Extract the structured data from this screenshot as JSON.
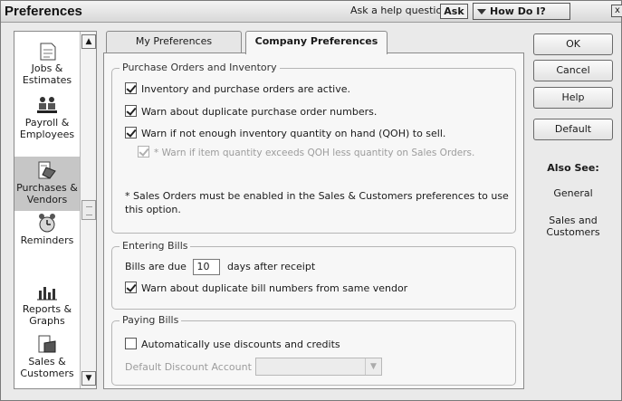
{
  "window": {
    "title": "Preferences"
  },
  "help": {
    "question_label": "Ask a help question",
    "ask_button": "Ask",
    "how_do_i": "How Do I?",
    "close_label": "x"
  },
  "icon_list": [
    {
      "label": "Jobs & Estimates",
      "icon": "jobs-estimates-icon"
    },
    {
      "label": "Payroll & Employees",
      "icon": "payroll-employees-icon"
    },
    {
      "label": "Purchases & Vendors",
      "icon": "purchases-vendors-icon",
      "selected": true
    },
    {
      "label": "Reminders",
      "icon": "reminders-icon"
    },
    {
      "label": "Reports & Graphs",
      "icon": "reports-graphs-icon"
    },
    {
      "label": "Sales & Customers",
      "icon": "sales-customers-icon"
    }
  ],
  "tabs": [
    {
      "label": "My Preferences",
      "active": false
    },
    {
      "label": "Company Preferences",
      "active": true
    }
  ],
  "purchase_orders": {
    "title": "Purchase Orders and Inventory",
    "inventory_active": "Inventory and purchase orders are active.",
    "warn_duplicate_po": "Warn about duplicate purchase order numbers.",
    "warn_not_enough": "Warn if not enough inventory quantity on hand (QOH) to sell.",
    "warn_exceeds": "* Warn if item quantity exceeds QOH less quantity on Sales Orders.",
    "note": "* Sales Orders must be enabled in the Sales & Customers preferences to use this option."
  },
  "entering_bills": {
    "title": "Entering Bills",
    "bills_due_prefix": "Bills are due",
    "bills_due_days": "10",
    "bills_due_suffix": "days after receipt",
    "warn_duplicate_bill": "Warn about duplicate bill numbers from same vendor"
  },
  "paying_bills": {
    "title": "Paying Bills",
    "auto_discounts": "Automatically use discounts and credits",
    "discount_account_label": "Default Discount Account",
    "discount_account_value": ""
  },
  "buttons": {
    "ok": "OK",
    "cancel": "Cancel",
    "help": "Help",
    "default": "Default"
  },
  "also_see": {
    "title": "Also See:",
    "links": [
      "General",
      "Sales and Customers"
    ]
  }
}
